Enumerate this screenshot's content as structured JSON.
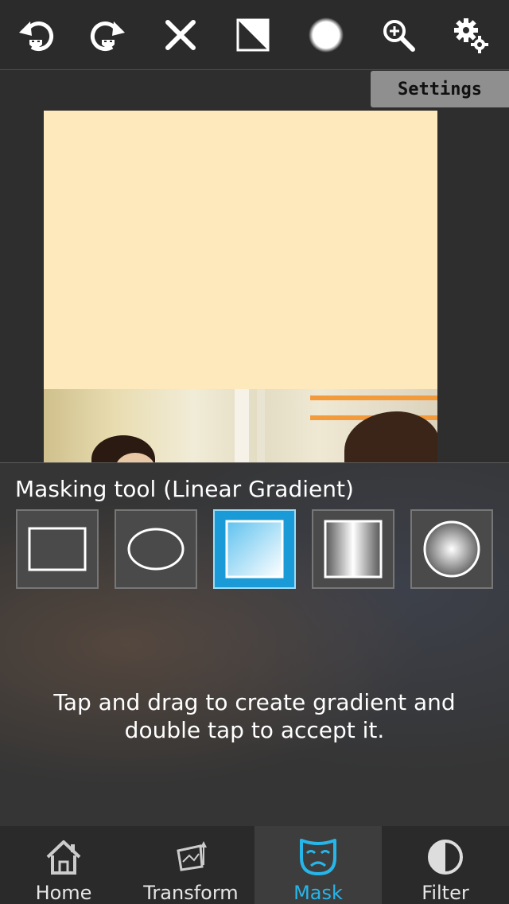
{
  "toolbar": {
    "buttons": [
      {
        "name": "undo-icon"
      },
      {
        "name": "redo-icon"
      },
      {
        "name": "close-icon"
      },
      {
        "name": "invert-mask-icon"
      },
      {
        "name": "brush-softness-icon"
      },
      {
        "name": "zoom-icon"
      },
      {
        "name": "settings-gears-icon"
      }
    ]
  },
  "settings_chip": {
    "label": "Settings"
  },
  "panel": {
    "title": "Masking tool (Linear Gradient)",
    "tools": [
      {
        "name": "rectangle-mask-tool",
        "icon": "rectangle-icon",
        "selected": false
      },
      {
        "name": "ellipse-mask-tool",
        "icon": "ellipse-icon",
        "selected": false
      },
      {
        "name": "linear-gradient-tool",
        "icon": "linear-gradient-icon",
        "selected": true
      },
      {
        "name": "mirrored-gradient-tool",
        "icon": "mirrored-gradient-icon",
        "selected": false
      },
      {
        "name": "radial-gradient-tool",
        "icon": "radial-gradient-icon",
        "selected": false
      }
    ],
    "hint_line1": "Tap and drag to create gradient and",
    "hint_line2": "double tap to accept it."
  },
  "tabs": [
    {
      "label": "Home",
      "icon": "home-icon",
      "active": false
    },
    {
      "label": "Transform",
      "icon": "transform-icon",
      "active": false
    },
    {
      "label": "Mask",
      "icon": "mask-icon",
      "active": true
    },
    {
      "label": "Filter",
      "icon": "filter-icon",
      "active": false
    }
  ],
  "colors": {
    "accent": "#27b6ea",
    "selected_tool": "#1a9bd7",
    "mask_fill": "#fde9bc"
  }
}
